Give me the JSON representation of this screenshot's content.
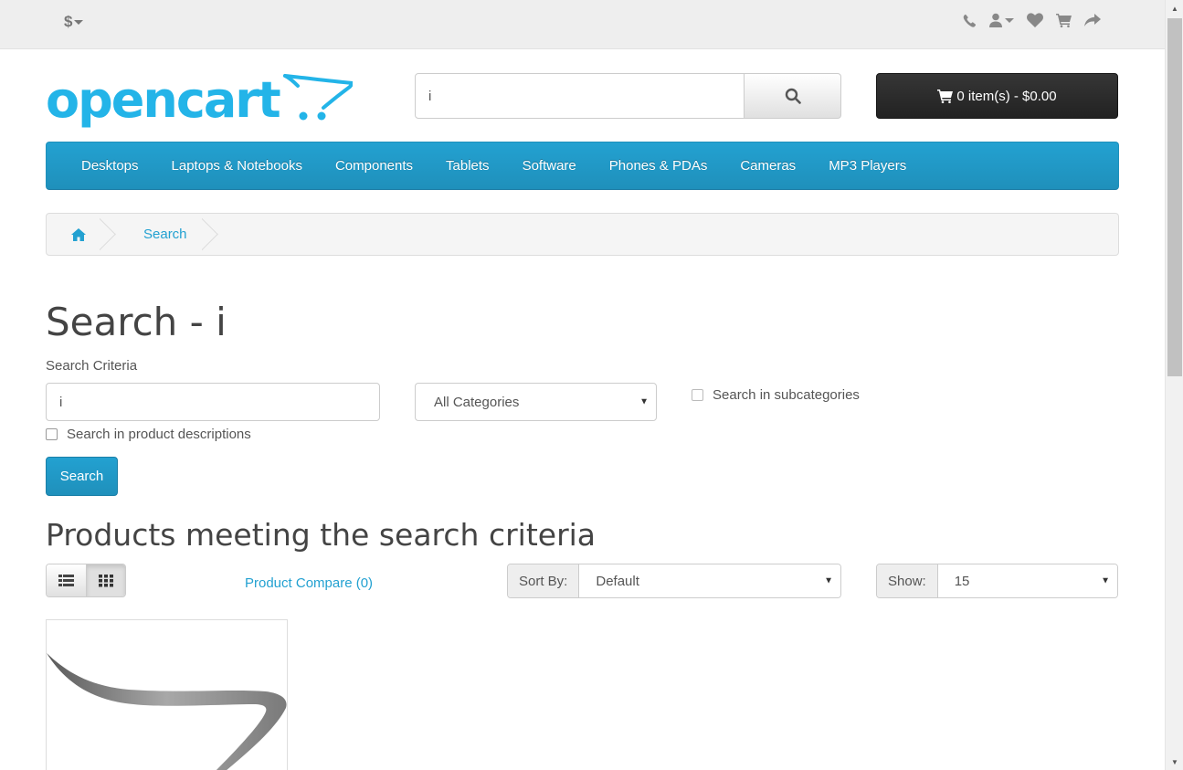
{
  "top_bar": {
    "currency": "$",
    "links": [
      "phone-icon",
      "user-icon",
      "heart-icon",
      "cart-icon",
      "share-icon"
    ]
  },
  "header": {
    "logo_text": "opencart",
    "search": {
      "value": "i",
      "placeholder": ""
    },
    "cart_label": "0 item(s) - $0.00"
  },
  "menu": {
    "items": [
      "Desktops",
      "Laptops & Notebooks",
      "Components",
      "Tablets",
      "Software",
      "Phones & PDAs",
      "Cameras",
      "MP3 Players"
    ]
  },
  "breadcrumb": {
    "items": [
      "Search"
    ]
  },
  "page": {
    "title": "Search - i",
    "criteria_label": "Search Criteria",
    "criteria_value": "i",
    "category_selected": "All Categories",
    "subcategories_label": "Search in subcategories",
    "descriptions_label": "Search in product descriptions",
    "search_button": "Search",
    "products_title": "Products meeting the search criteria",
    "compare_link": "Product Compare (0)",
    "sort_label": "Sort By:",
    "sort_value": "Default",
    "show_label": "Show:",
    "show_value": "15"
  },
  "colors": {
    "accent": "#23a1d1",
    "cart": "#222222",
    "topbar": "#eeeeee"
  }
}
